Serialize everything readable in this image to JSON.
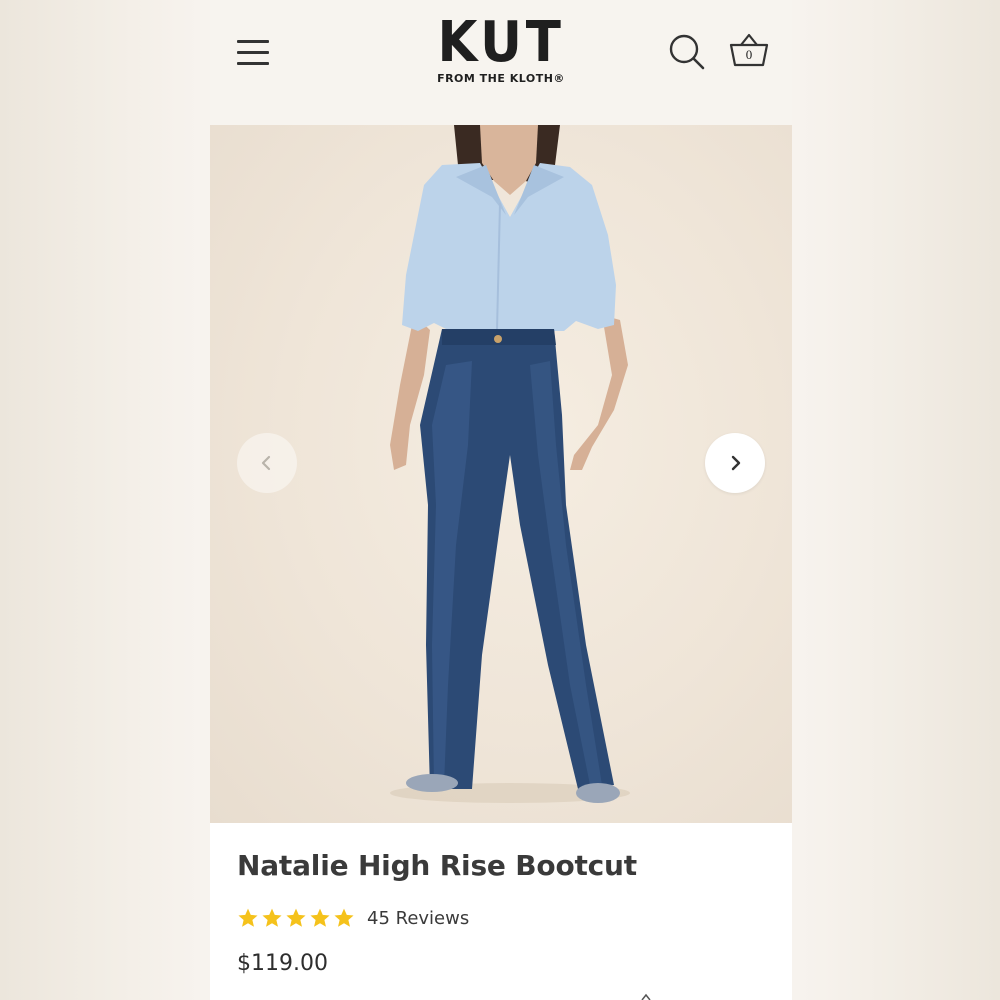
{
  "header": {
    "logo_main": "KUT",
    "logo_sub": "FROM THE KLOTH®",
    "cart_count": "0",
    "icons": {
      "menu": "hamburger-menu-icon",
      "search": "search-icon",
      "cart": "basket-icon"
    }
  },
  "gallery": {
    "prev_icon": "chevron-left-icon",
    "next_icon": "chevron-right-icon"
  },
  "product": {
    "title": "Natalie High Rise Bootcut",
    "rating": 5,
    "rating_max": 5,
    "reviews_label": "45 Reviews",
    "price": "$119.00"
  },
  "colors": {
    "header_bg": "#f7f4ef",
    "star": "#f5c21b",
    "text": "#3a3a3a",
    "shirt": "#bcd3ea",
    "denim": "#2c4a75"
  }
}
